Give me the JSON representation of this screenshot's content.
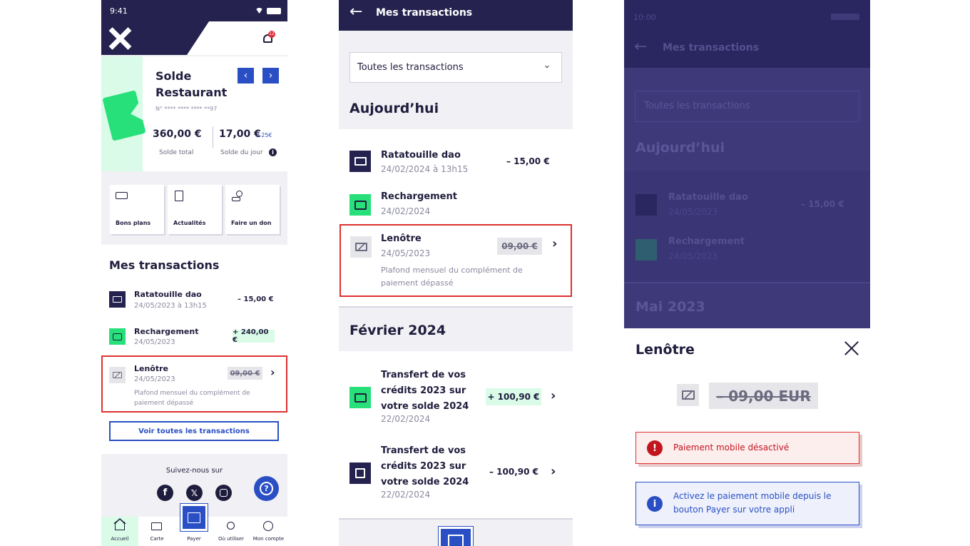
{
  "colors": {
    "navy": "#25224f",
    "green": "#27e07a",
    "light_green": "#d9fbe7",
    "blue": "#2a4fc4",
    "red_outline": "#e03030",
    "error": "#c2161f"
  },
  "screen1": {
    "time": "9:41",
    "notif_count": "12",
    "balance": {
      "title_line1": "Solde",
      "title_line2": "Restaurant",
      "card_number": "N° **** **** **** **97",
      "total": "360,00 €",
      "total_label": "Solde total",
      "day": "17,00 €",
      "day_limit": "/ 25€",
      "day_label": "Solde du jour"
    },
    "shortcuts": [
      {
        "label": "Bons plans",
        "icon": "ticket-icon"
      },
      {
        "label": "Actualités",
        "icon": "document-icon"
      },
      {
        "label": "Faire un don",
        "icon": "donate-icon"
      }
    ],
    "section_title": "Mes transactions",
    "transactions": [
      {
        "name": "Ratatouille dao",
        "date": "24/05/2023 à 13h15",
        "amount": "– 15,00 €"
      },
      {
        "name": "Rechargement",
        "date": "24/05/2023",
        "amount": "+ 240,00 €"
      },
      {
        "name": "Lenôtre",
        "date": "24/05/2023",
        "amount": "09,00 €",
        "note": "Plafond mensuel du complément de paiement dépassé"
      }
    ],
    "view_all": "Voir toutes les transactions",
    "follow": "Suivez-nous sur",
    "nav": [
      "Accueil",
      "Carte",
      "Payer",
      "Où utiliser",
      "Mon compte"
    ]
  },
  "screen2": {
    "title": "Mes transactions",
    "filter": "Toutes les transactions",
    "section_today": "Aujourd’hui",
    "today": [
      {
        "name": "Ratatouille dao",
        "date": "24/02/2024 à 13h15",
        "amount": "– 15,00 €"
      },
      {
        "name": "Rechargement",
        "date": "24/02/2024"
      },
      {
        "name": "Lenôtre",
        "date": "24/05/2023",
        "amount": "09,00 €",
        "note": "Plafond mensuel du complément de paiement dépassé"
      }
    ],
    "section_feb": "Février 2024",
    "feb": [
      {
        "name_lines": [
          "Transfert de vos",
          "crédits 2023 sur",
          "votre solde 2024"
        ],
        "date": "22/02/2024",
        "amount": "+ 100,90 €"
      },
      {
        "name_lines": [
          "Transfert de vos",
          "crédits 2023 sur",
          "votre solde 2024"
        ],
        "date": "22/02/2024",
        "amount": "– 100,90 €"
      }
    ]
  },
  "screen3": {
    "time": "10:00",
    "title": "Mes transactions",
    "filter": "Toutes les transactions",
    "section_today": "Aujourd’hui",
    "rows": [
      {
        "name": "Ratatouille dao",
        "date": "24/05/2023",
        "amount": "– 15,00 €"
      },
      {
        "name": "Rechargement",
        "date": "24/05/2023"
      }
    ],
    "section_may": "Mai 2023",
    "sheet": {
      "title": "Lenôtre",
      "amount": "– 09,00 EUR",
      "error": "Paiement mobile désactivé",
      "info": "Activez le paiement mobile depuis le bouton Payer sur votre appli"
    }
  }
}
